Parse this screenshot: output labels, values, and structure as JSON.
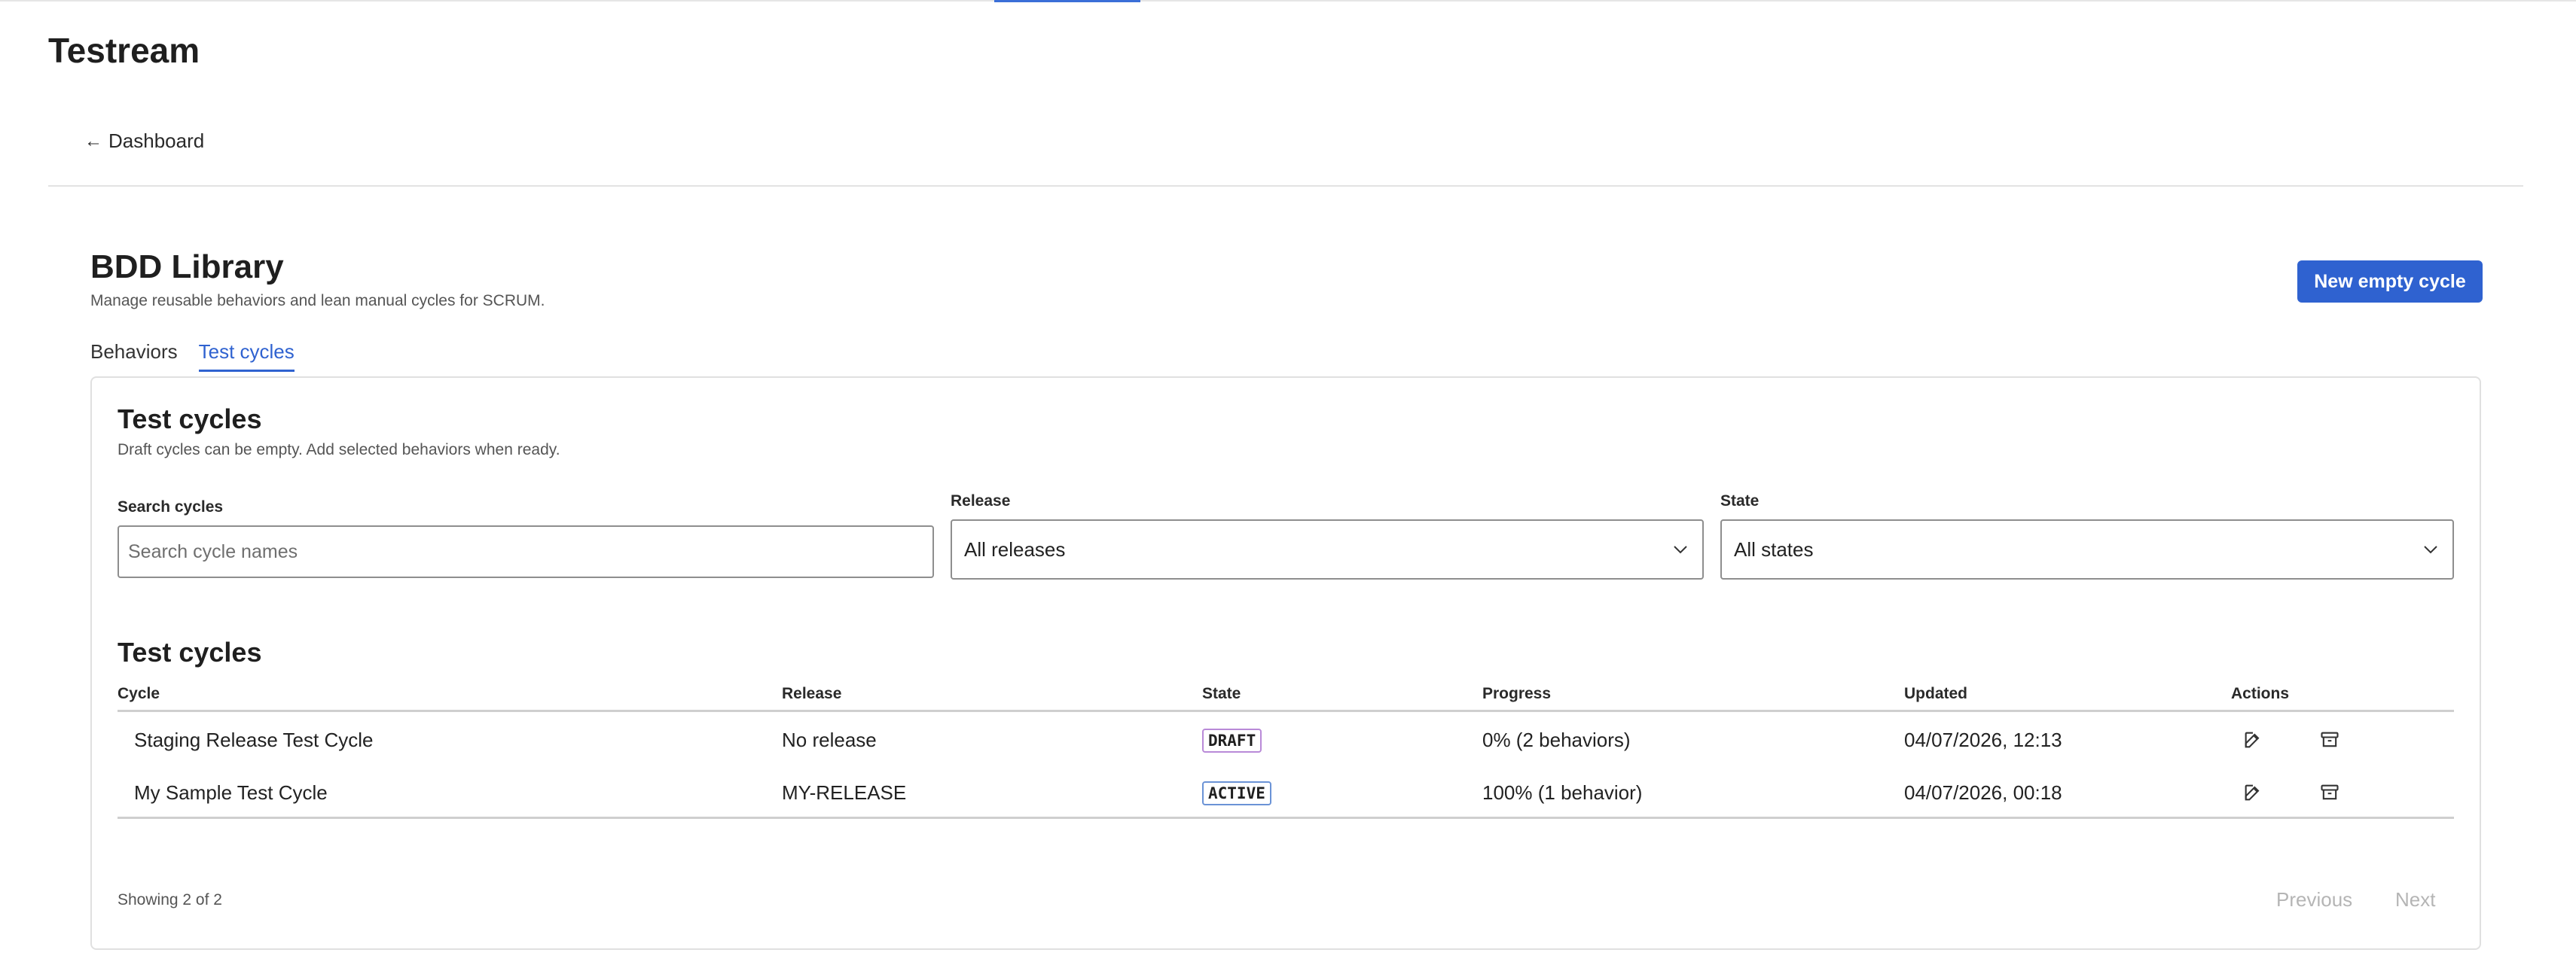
{
  "app": {
    "title": "Testream"
  },
  "nav": {
    "back_label": "Dashboard",
    "back_icon": "arrow-left-icon"
  },
  "page": {
    "title": "BDD Library",
    "subtitle": "Manage reusable behaviors and lean manual cycles for SCRUM.",
    "primary_button": "New empty cycle",
    "accent_color": "#2f62d0"
  },
  "tabs": [
    {
      "label": "Behaviors",
      "active": false
    },
    {
      "label": "Test cycles",
      "active": true
    }
  ],
  "panel": {
    "title": "Test cycles",
    "subtitle": "Draft cycles can be empty. Add selected behaviors when ready."
  },
  "filters": {
    "search": {
      "label": "Search cycles",
      "placeholder": "Search cycle names",
      "value": ""
    },
    "release": {
      "label": "Release",
      "selected": "All releases"
    },
    "state": {
      "label": "State",
      "selected": "All states"
    }
  },
  "table": {
    "title": "Test cycles",
    "columns": [
      "Cycle",
      "Release",
      "State",
      "Progress",
      "Updated",
      "Actions"
    ],
    "rows": [
      {
        "cycle": "Staging Release Test Cycle",
        "release": "No release",
        "state": "DRAFT",
        "progress": "0% (2 behaviors)",
        "updated": "04/07/2026, 12:13"
      },
      {
        "cycle": "My Sample Test Cycle",
        "release": "MY-RELEASE",
        "state": "ACTIVE",
        "progress": "100% (1 behavior)",
        "updated": "04/07/2026, 00:18"
      }
    ],
    "action_icons": [
      "edit-icon",
      "archive-icon"
    ]
  },
  "pagination": {
    "summary": "Showing 2 of 2",
    "previous": "Previous",
    "next": "Next"
  }
}
